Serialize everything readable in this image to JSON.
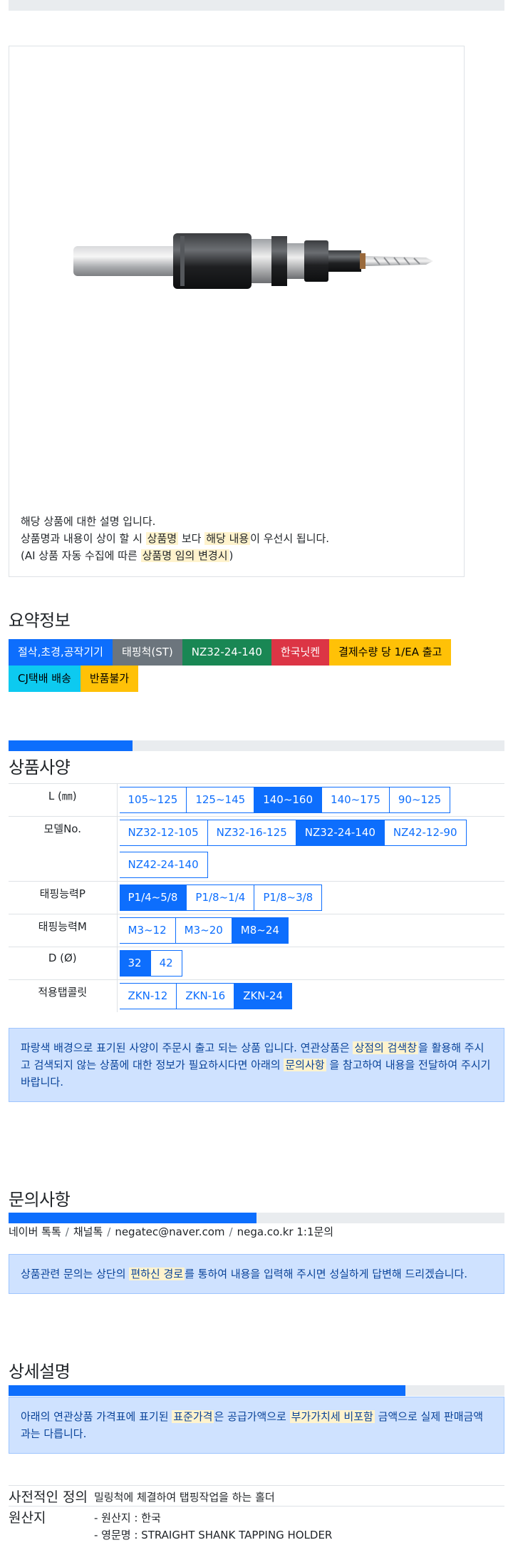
{
  "description": {
    "line1": "해당 상품에 대한 설명 입니다.",
    "line2_pre": "상품명과 내용이 상이 할 시 ",
    "line2_hl1": "상품명",
    "line2_mid": " 보다 ",
    "line2_hl2": "해당 내용",
    "line2_post": "이 우선시 됩니다.",
    "line3_pre": "(AI 상품 자동 수집에 따른 ",
    "line3_hl": "상품명 임의 변경시",
    "line3_post": ")"
  },
  "summary": {
    "title": "요약정보",
    "badges": [
      {
        "label": "절삭,초경,공작기기",
        "color": "primary"
      },
      {
        "label": "태핑척(ST)",
        "color": "secondary"
      },
      {
        "label": "NZ32-24-140",
        "color": "success"
      },
      {
        "label": "한국닛켄",
        "color": "danger"
      },
      {
        "label": "결제수량 당 1/EA 출고",
        "color": "warning"
      },
      {
        "label": "CJ택배 배송",
        "color": "info"
      },
      {
        "label": "반품불가",
        "color": "warning"
      }
    ],
    "progress_fraction": 0.25
  },
  "specs": {
    "title": "상품사양",
    "rows": [
      {
        "label": "L (㎜)",
        "options": [
          {
            "label": "105~125",
            "active": false
          },
          {
            "label": "125~145",
            "active": false
          },
          {
            "label": "140~160",
            "active": true
          },
          {
            "label": "140~175",
            "active": false
          },
          {
            "label": "90~125",
            "active": false
          }
        ]
      },
      {
        "label": "모델No.",
        "options": [
          {
            "label": "NZ32-12-105",
            "active": false
          },
          {
            "label": "NZ32-16-125",
            "active": false
          },
          {
            "label": "NZ32-24-140",
            "active": true
          },
          {
            "label": "NZ42-12-90",
            "active": false
          },
          {
            "label": "NZ42-24-140",
            "active": false
          }
        ]
      },
      {
        "label": "태핑능력P",
        "options": [
          {
            "label": "P1/4~5/8",
            "active": true
          },
          {
            "label": "P1/8~1/4",
            "active": false
          },
          {
            "label": "P1/8~3/8",
            "active": false
          }
        ]
      },
      {
        "label": "태핑능력M",
        "options": [
          {
            "label": "M3~12",
            "active": false
          },
          {
            "label": "M3~20",
            "active": false
          },
          {
            "label": "M8~24",
            "active": true
          }
        ]
      },
      {
        "label": "D (Ø)",
        "options": [
          {
            "label": "32",
            "active": true
          },
          {
            "label": "42",
            "active": false
          }
        ]
      },
      {
        "label": "적용탭콜릿",
        "options": [
          {
            "label": "ZKN-12",
            "active": false
          },
          {
            "label": "ZKN-16",
            "active": false
          },
          {
            "label": "ZKN-24",
            "active": true
          }
        ]
      }
    ],
    "notice_pre": "파랑색 배경으로 표기된 사양이 주문시 출고 되는 상품 입니다. 연관상품은 ",
    "notice_hl1": "상점의 검색창",
    "notice_mid": "을 활용해 주시고 검색되지 않는 상품에 대한 정보가 필요하시다면 아래의 ",
    "notice_hl2": "문의사항",
    "notice_post": " 을 참고하여 내용을 전달하여 주시기 바랍니다."
  },
  "inquiry": {
    "title": "문의사항",
    "progress_fraction": 0.5,
    "channels": [
      "네이버 톡톡",
      "채널톡",
      "negatec@naver.com",
      "nega.co.kr 1:1문의"
    ],
    "notice_pre": "상품관련 문의는 상단의 ",
    "notice_hl": "편하신 경로",
    "notice_post": "를 통하여 내용을 입력해 주시면 성실하게 답변해 드리겠습니다."
  },
  "detail": {
    "title": "상세설명",
    "progress_fraction": 0.8,
    "notice_pre": "아래의 연관상품 가격표에 표기된 ",
    "notice_hl1": "표준가격",
    "notice_mid": "은 공급가액으로 ",
    "notice_hl2": "부가가치세 비포함",
    "notice_post": " 금액으로 실제 판매금액과는 다릅니다.",
    "rows": [
      {
        "key": "사전적인 정의",
        "lines": [
          "밀링척에 체결하여 탭핑작업을 하는 홀더"
        ]
      },
      {
        "key": "원산지",
        "lines": [
          "- 원산지 : 한국",
          "- 영문명 : STRAIGHT SHANK TAPPING HOLDER"
        ]
      }
    ]
  }
}
